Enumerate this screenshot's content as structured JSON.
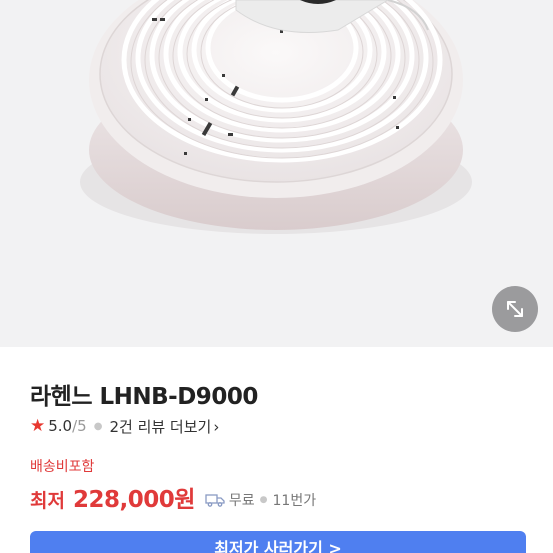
{
  "product": {
    "title": "라헨느 LHNB-D9000",
    "rating": {
      "score": "5.0",
      "max": "/5",
      "star_icon": "star-icon"
    },
    "reviews_link": "2건 리뷰 더보기",
    "shipping_label": "배송비포함",
    "price_prefix": "최저",
    "price": "228,000원",
    "delivery": "무료",
    "seller_count": "11번가",
    "cta_label": "최저가 사러가기 >"
  },
  "colors": {
    "accent_red": "#e03a3a",
    "star": "#e8382f",
    "cta_blue": "#4f7ff0"
  },
  "icons": {
    "expand": "expand-arrows-icon",
    "truck": "truck-icon"
  }
}
